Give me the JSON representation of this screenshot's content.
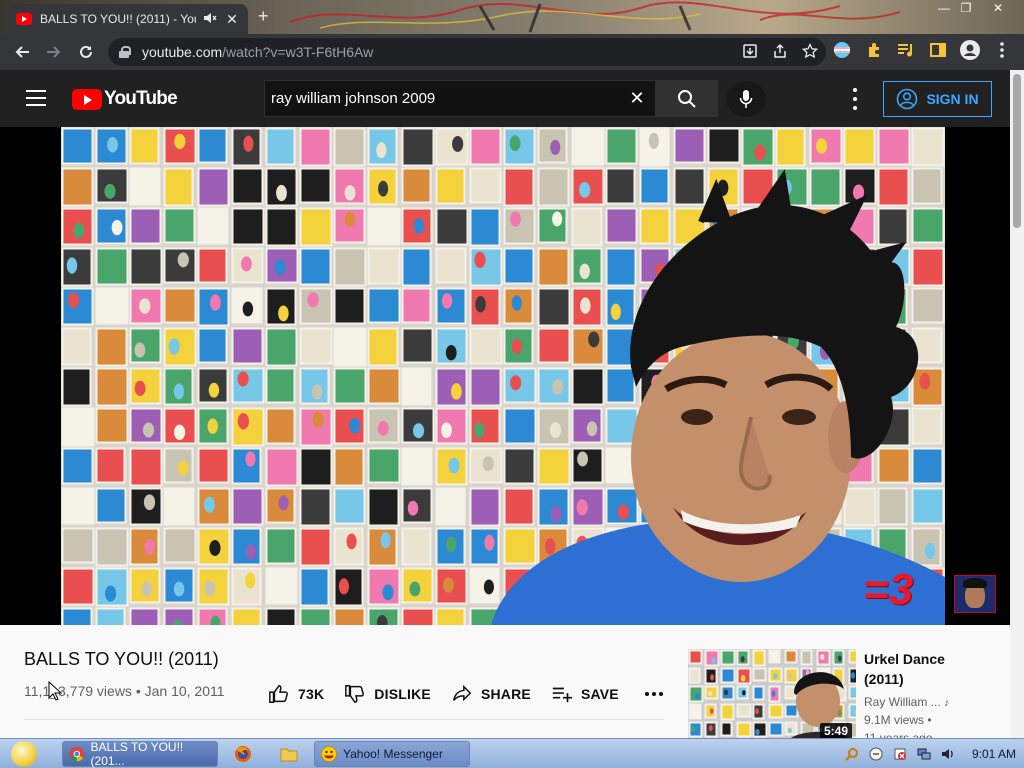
{
  "browser": {
    "tab_title": "BALLS TO YOU!! (2011) - You",
    "tab_mute_icon": "speaker-muted-icon",
    "tab_close": "✕",
    "new_tab": "+",
    "url_domain": "youtube.com",
    "url_path": "/watch?v=w3T-F6tH6Aw",
    "window_controls": [
      "—",
      "❐",
      "✕"
    ]
  },
  "youtube": {
    "logo_text": "YouTube",
    "search_value": "ray william johnson 2009",
    "signin_label": "SIGN IN"
  },
  "video": {
    "overlay_text": "=3",
    "title": "BALLS TO YOU!! (2011)",
    "views": "11,1_3,779 views",
    "date": "Jan 10, 2011",
    "meta": "11,1_3,779 views • Jan 10, 2011",
    "like_count": "73K",
    "dislike_label": "DISLIKE",
    "share_label": "SHARE",
    "save_label": "SAVE"
  },
  "recommendation": {
    "title": "Urkel Dance (2011)",
    "channel": "Ray William ...",
    "views": "9.1M views •",
    "age": "11 years ago",
    "duration": "5:49"
  },
  "taskbar": {
    "items": [
      {
        "label": "BALLS TO YOU!! (201...",
        "icon": "chrome-icon",
        "active": true
      },
      {
        "label": "Yahoo! Messenger",
        "icon": "yahoo-messenger-icon",
        "active": false
      }
    ],
    "clock": "9:01 AM"
  },
  "colors": {
    "youtube_red": "#ff0000",
    "signin_blue": "#3ea6ff",
    "overlay_red": "#e8192c"
  }
}
